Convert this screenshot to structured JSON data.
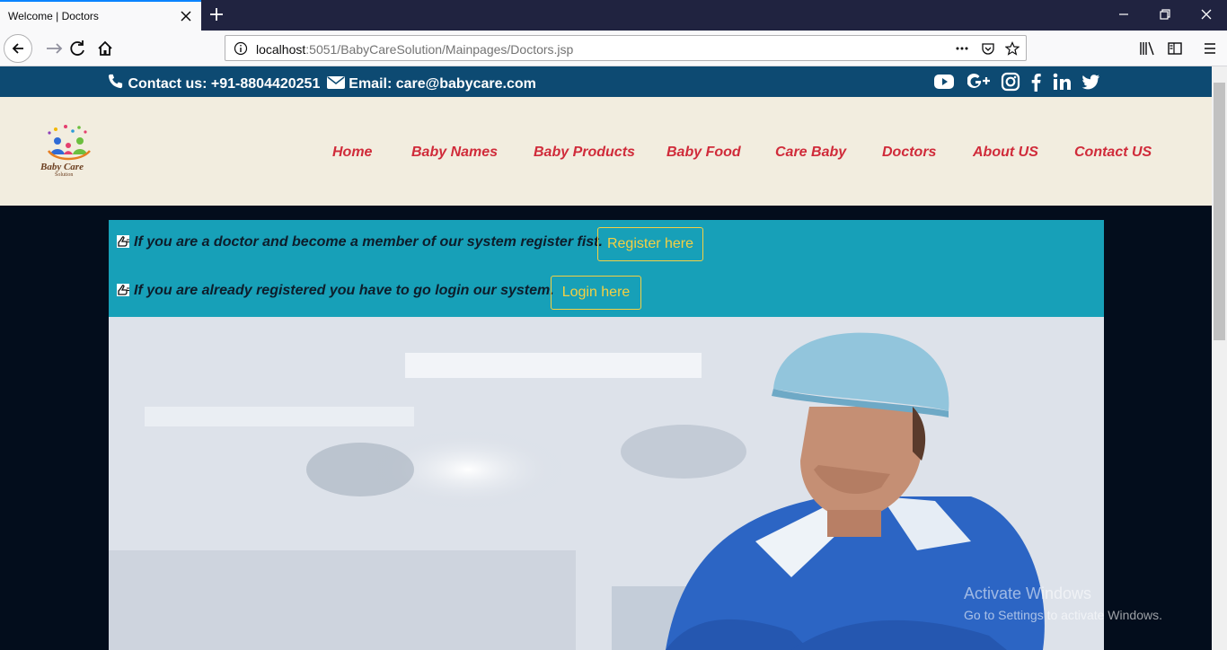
{
  "browser": {
    "tab_title": "Welcome | Doctors",
    "url_host": "localhost",
    "url_rest": ":5051/BabyCareSolution/Mainpages/Doctors.jsp"
  },
  "topbar": {
    "phone": "Contact us: +91-8804420251",
    "email": "Email: care@babycare.com",
    "social_icons": [
      "youtube-icon",
      "google-plus-icon",
      "instagram-icon",
      "facebook-icon",
      "linkedin-icon",
      "twitter-icon"
    ]
  },
  "logo": {
    "title": "Baby Care",
    "subtitle": "Solution"
  },
  "menu": {
    "home": "Home",
    "baby_names": "Baby Names",
    "baby_products": "Baby Products",
    "baby_food": "Baby Food",
    "care_baby": "Care Baby",
    "doctors": "Doctors",
    "about": "About US",
    "contact": "Contact US"
  },
  "notice": {
    "line1": "If you are a doctor and become a member of our system register fist.",
    "register_label": "Register here",
    "line2": "If you are already registered you have to go login our system.",
    "login_label": "Login here"
  },
  "watermark": {
    "title": "Activate Windows",
    "subtitle": "Go to Settings to activate Windows."
  },
  "colors": {
    "topbar": "#0d4a72",
    "header": "#f2eddf",
    "menu_text": "#d02b3a",
    "notice_bg": "#17a0b8",
    "button_accent": "#f5d042"
  }
}
